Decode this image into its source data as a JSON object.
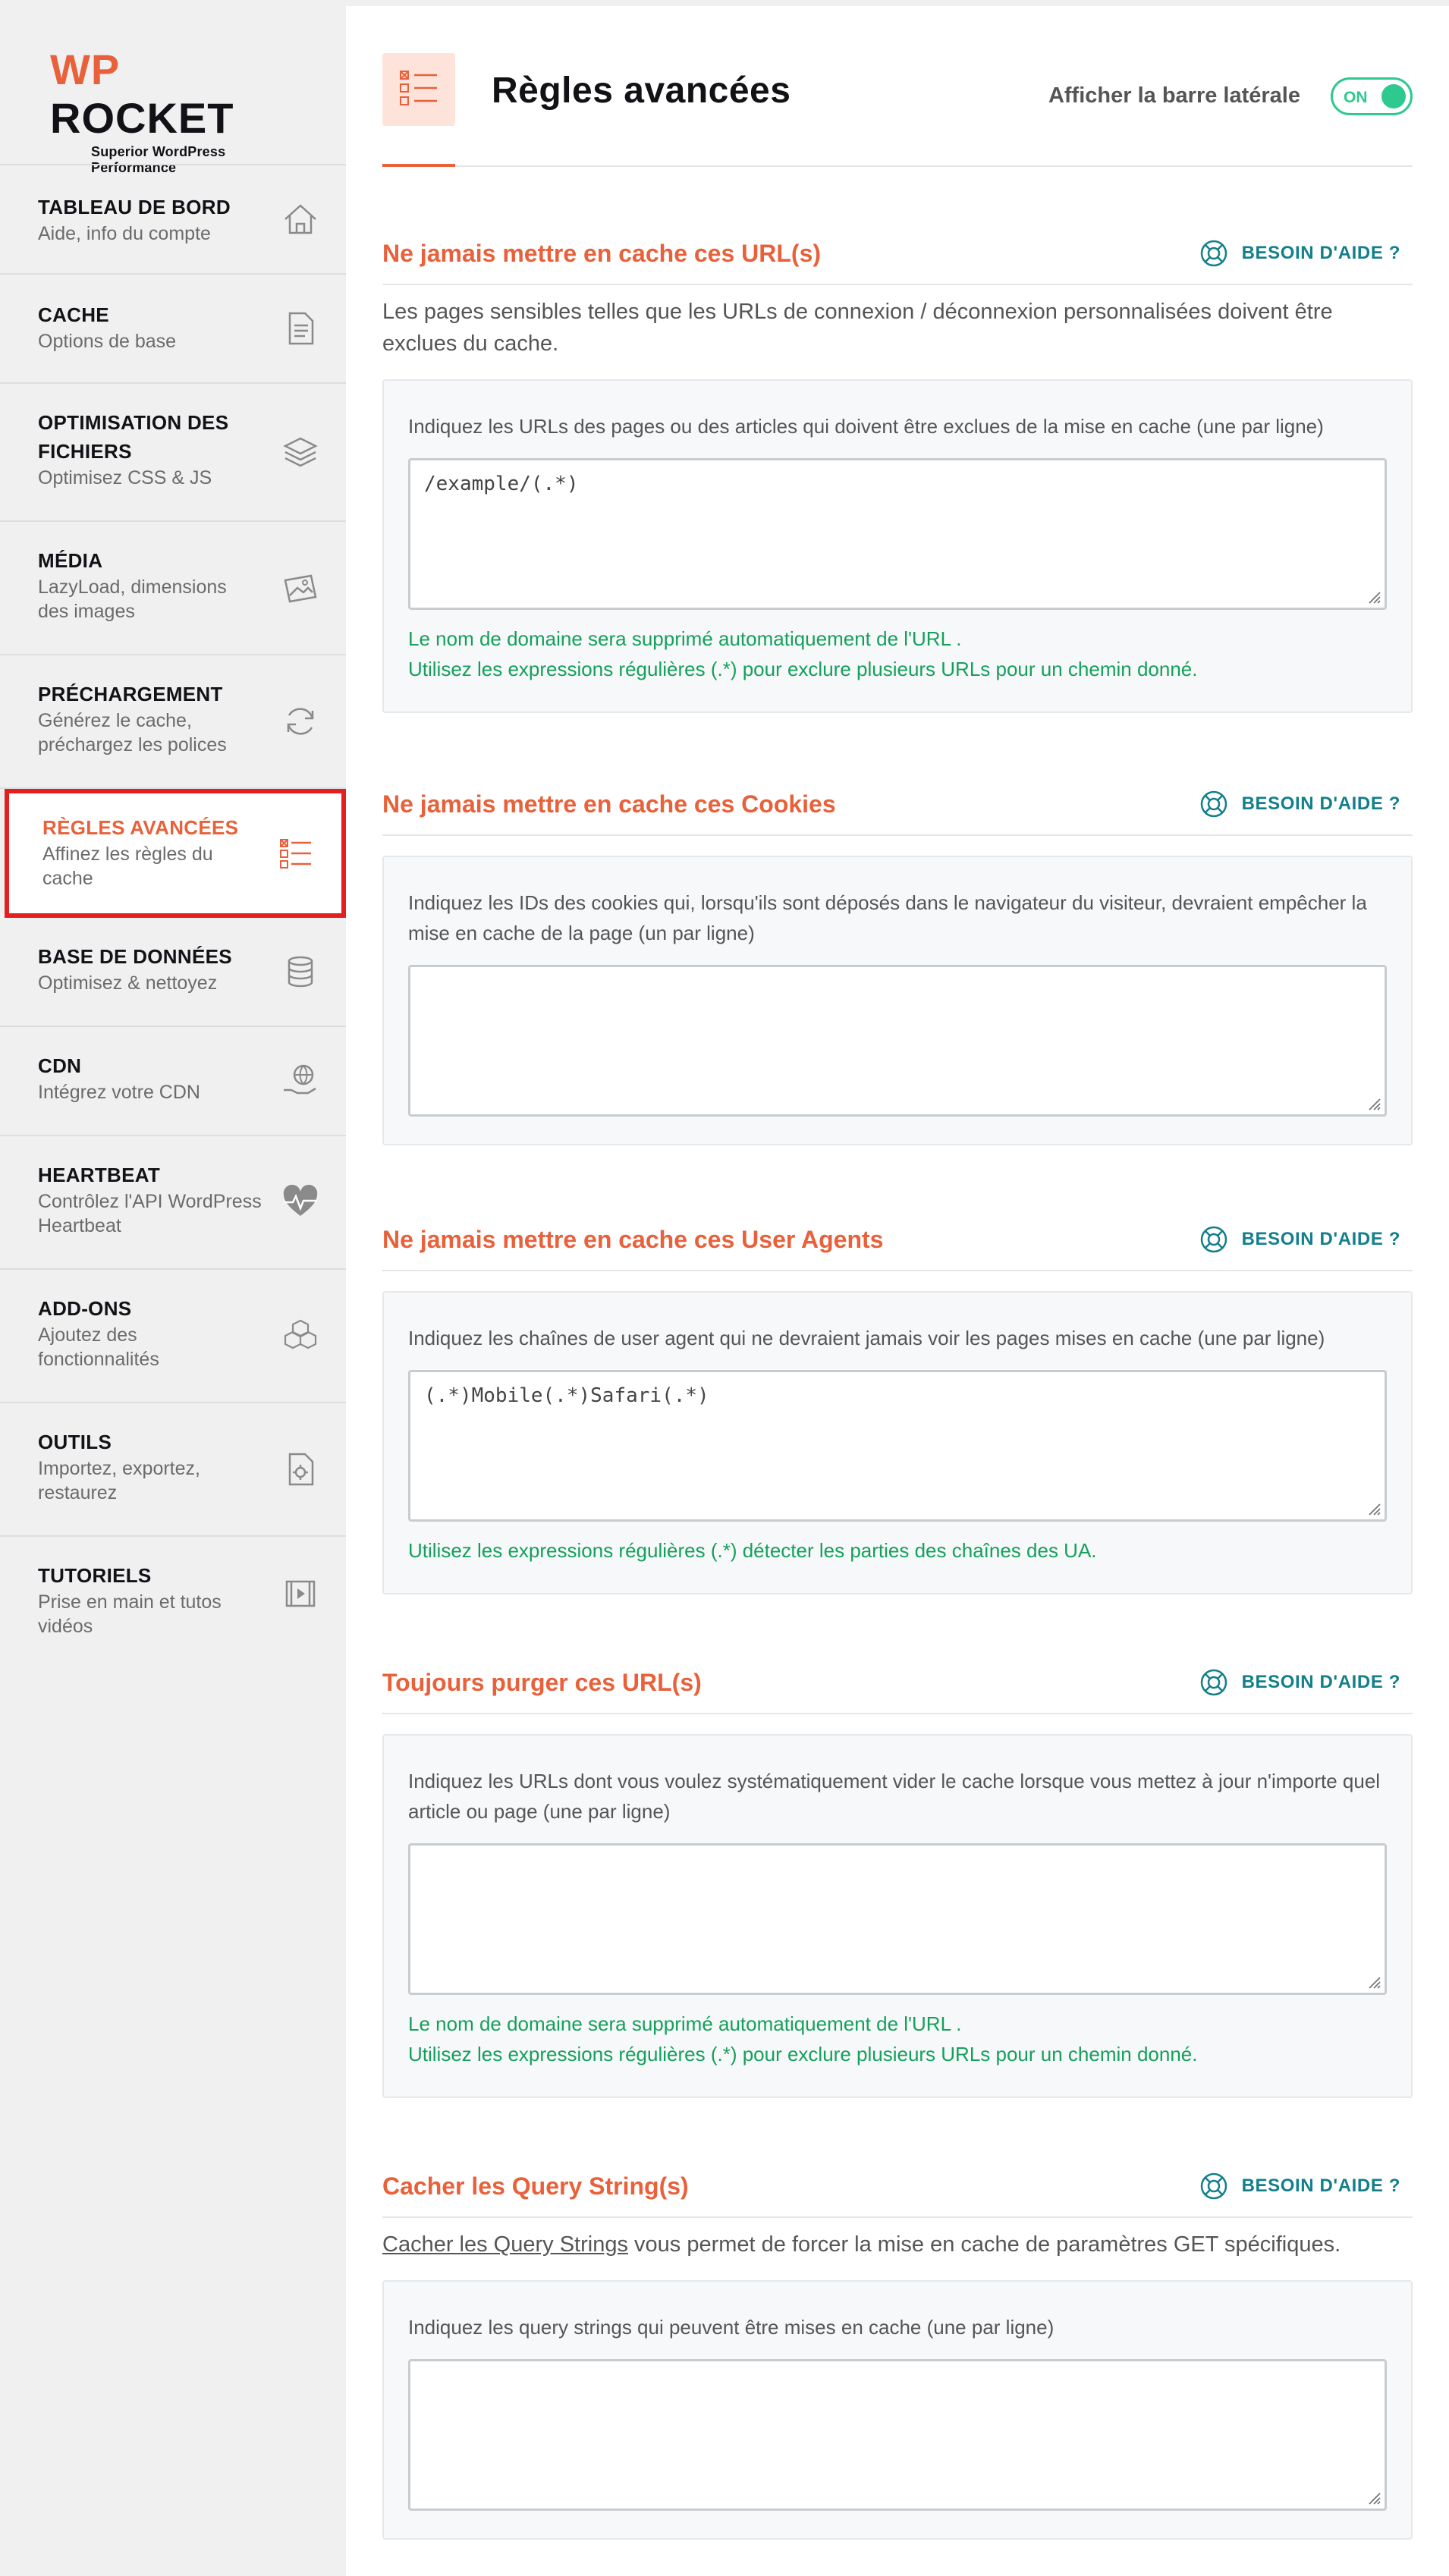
{
  "brand": {
    "wp": "WP",
    "rocket": "ROCKET",
    "tagline": "Superior WordPress Performance"
  },
  "sidebar": {
    "items": [
      {
        "title": "TABLEAU DE BORD",
        "subtitle": "Aide, info du compte",
        "icon": "home-icon"
      },
      {
        "title": "CACHE",
        "subtitle": "Options de base",
        "icon": "file-icon"
      },
      {
        "title": "OPTIMISATION DES FICHIERS",
        "subtitle": "Optimisez CSS & JS",
        "icon": "layers-icon"
      },
      {
        "title": "MÉDIA",
        "subtitle": "LazyLoad, dimensions des images",
        "icon": "image-icon"
      },
      {
        "title": "PRÉCHARGEMENT",
        "subtitle": "Générez le cache, préchargez les polices",
        "icon": "refresh-icon"
      },
      {
        "title": "RÈGLES AVANCÉES",
        "subtitle": "Affinez les règles du cache",
        "icon": "checklist-icon"
      },
      {
        "title": "BASE DE DONNÉES",
        "subtitle": "Optimisez & nettoyez",
        "icon": "database-icon"
      },
      {
        "title": "CDN",
        "subtitle": "Intégrez votre CDN",
        "icon": "globe-hand-icon"
      },
      {
        "title": "HEARTBEAT",
        "subtitle": "Contrôlez l'API WordPress Heartbeat",
        "icon": "heartbeat-icon"
      },
      {
        "title": "ADD-ONS",
        "subtitle": "Ajoutez des fonctionnalités",
        "icon": "cubes-icon"
      },
      {
        "title": "OUTILS",
        "subtitle": "Importez, exportez, restaurez",
        "icon": "gear-file-icon"
      },
      {
        "title": "TUTORIELS",
        "subtitle": "Prise en main et tutos vidéos",
        "icon": "video-icon"
      }
    ]
  },
  "header": {
    "title": "Règles avancées",
    "toggle_label": "Afficher la barre latérale",
    "toggle_state": "ON"
  },
  "help_label": "BESOIN D'AIDE ?",
  "sections": {
    "urls": {
      "title": "Ne jamais mettre en cache ces URL(s)",
      "description": "Les pages sensibles telles que les URLs de connexion / déconnexion personnalisées doivent être exclues du cache.",
      "label": "Indiquez les URLs des pages ou des articles qui doivent être exclues de la mise en cache (une par ligne)",
      "value": "/example/(.*)",
      "note1": "Le nom de domaine sera supprimé automatiquement de l'URL .",
      "note2": "Utilisez les expressions régulières (.*) pour exclure plusieurs URLs pour un chemin donné."
    },
    "cookies": {
      "title": "Ne jamais mettre en cache ces Cookies",
      "label": "Indiquez les IDs des cookies qui, lorsqu'ils sont déposés dans le navigateur du visiteur, devraient empêcher la mise en cache de la page (un par ligne)",
      "value": ""
    },
    "agents": {
      "title": "Ne jamais mettre en cache ces User Agents",
      "label": "Indiquez les chaînes de user agent qui ne devraient jamais voir les pages mises en cache (une par ligne)",
      "value": "(.*)Mobile(.*)Safari(.*)",
      "note1": "Utilisez les expressions régulières (.*) détecter les parties des chaînes des UA."
    },
    "purge": {
      "title": "Toujours purger ces URL(s)",
      "label": "Indiquez les URLs dont vous voulez systématiquement vider le cache lorsque vous mettez à jour n'importe quel article ou page (une par ligne)",
      "value": "",
      "note1": "Le nom de domaine sera supprimé automatiquement de l'URL .",
      "note2": "Utilisez les expressions régulières (.*) pour exclure plusieurs URLs pour un chemin donné."
    },
    "query": {
      "title": "Cacher les Query String(s)",
      "desc_link": "Cacher les Query Strings",
      "desc_rest": " vous permet de forcer la mise en cache de paramètres GET spécifiques.",
      "label": "Indiquez les query strings qui peuvent être mises en cache (une par ligne)",
      "value": ""
    }
  },
  "colors": {
    "accent": "#e8613a",
    "help": "#137f8b",
    "note": "#14a05c",
    "toggle": "#2ec98f",
    "active_border": "#e41f1f"
  }
}
